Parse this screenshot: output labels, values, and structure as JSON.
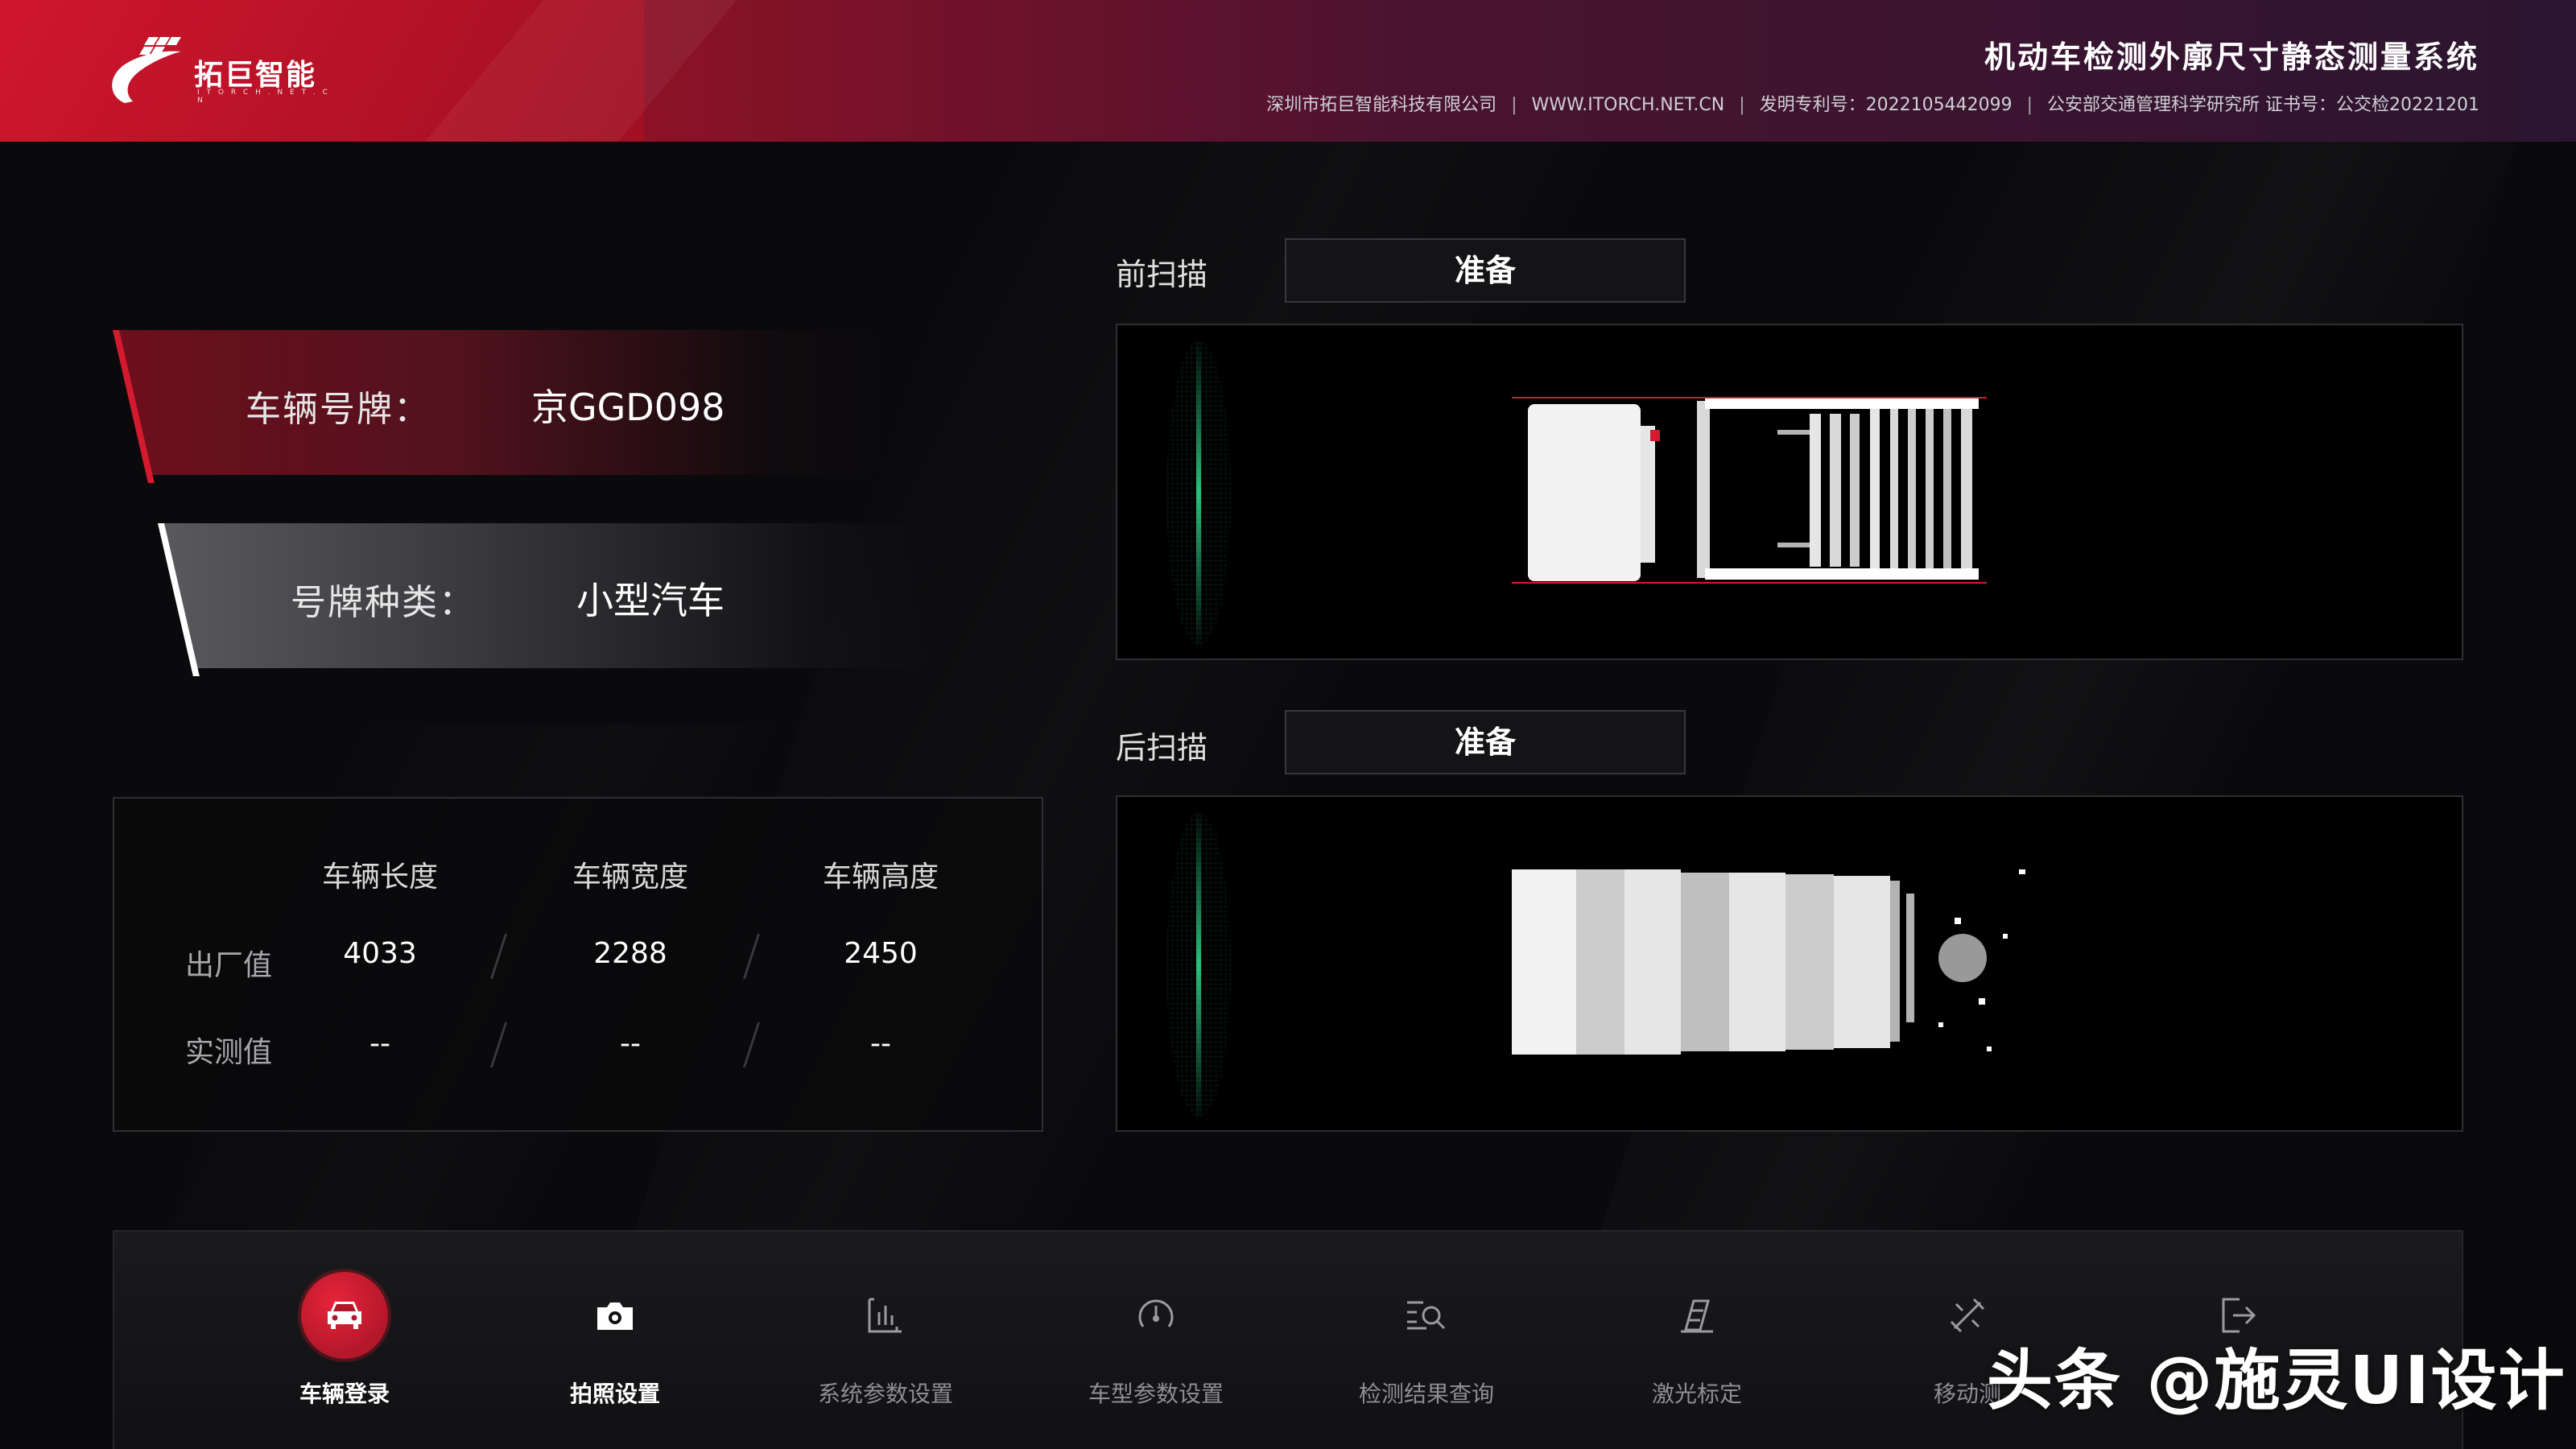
{
  "header": {
    "logo_name": "拓巨智能",
    "logo_sub": "I T O R C H . N E T . C N",
    "title": "机动车检测外廓尺寸静态测量系统",
    "info": [
      "深圳市拓巨智能科技有限公司",
      "WWW.ITORCH.NET.CN",
      "发明专利号：2022105442099",
      "公安部交通管理科学研究所 证书号：公交检20221201"
    ],
    "info_separator": "|"
  },
  "plate": {
    "label": "车辆号牌：",
    "value": "京GGD098"
  },
  "plate_type": {
    "label": "号牌种类：",
    "value": "小型汽车"
  },
  "dimensions": {
    "columns": [
      "车辆长度",
      "车辆宽度",
      "车辆高度"
    ],
    "rows": [
      {
        "label": "出厂值",
        "values": [
          "4033",
          "2288",
          "2450"
        ]
      },
      {
        "label": "实测值",
        "values": [
          "--",
          "--",
          "--"
        ]
      }
    ]
  },
  "front_scan": {
    "label": "前扫描",
    "status": "准备"
  },
  "rear_scan": {
    "label": "后扫描",
    "status": "准备"
  },
  "nav": {
    "items": [
      {
        "label": "车辆登录",
        "icon": "car-icon",
        "active": true
      },
      {
        "label": "拍照设置",
        "icon": "camera-icon",
        "active": false
      },
      {
        "label": "系统参数设置",
        "icon": "chart-icon",
        "active": false
      },
      {
        "label": "车型参数设置",
        "icon": "gauge-icon",
        "active": false
      },
      {
        "label": "检测结果查询",
        "icon": "search-list-icon",
        "active": false
      },
      {
        "label": "激光标定",
        "icon": "laser-icon",
        "active": false
      },
      {
        "label": "移动测",
        "icon": "tools-icon",
        "active": false
      },
      {
        "label": "",
        "icon": "exit-icon",
        "active": false
      }
    ]
  },
  "watermark": "头条 @施灵UI设计",
  "colors": {
    "accent_red": "#d41a2e",
    "scan_green": "#2fd58a",
    "background": "#0a0a0c"
  }
}
